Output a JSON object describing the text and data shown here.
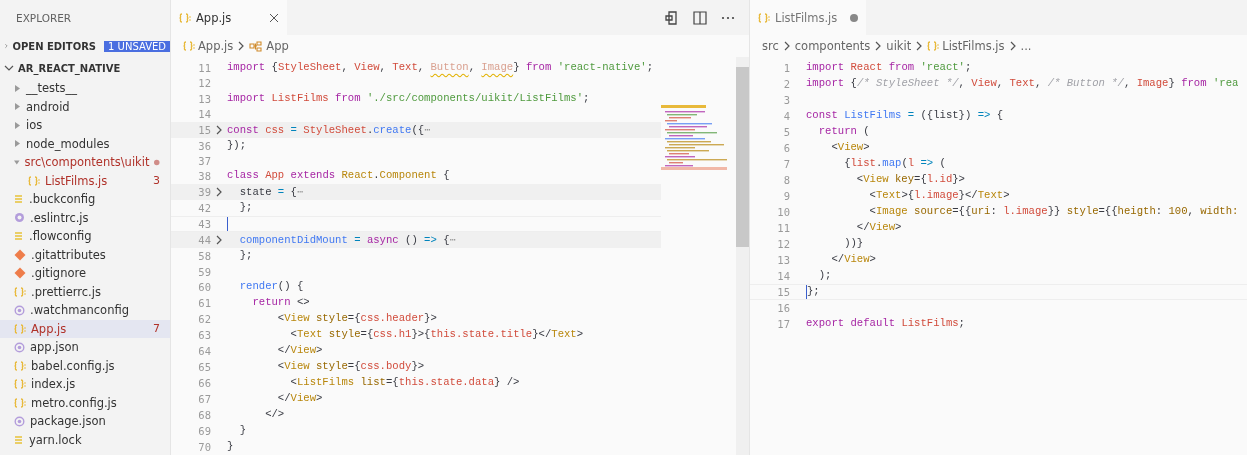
{
  "sidebar": {
    "title": "EXPLORER",
    "sections": [
      {
        "label": "OPEN EDITORS",
        "expanded": false,
        "badge": "1 UNSAVED"
      },
      {
        "label": "AR_REACT_NATIVE",
        "expanded": true,
        "items": [
          {
            "label": "__tests__",
            "kind": "folder",
            "expanded": false,
            "modified": false,
            "selected": false
          },
          {
            "label": "android",
            "kind": "folder",
            "expanded": false,
            "modified": false,
            "selected": false
          },
          {
            "label": "ios",
            "kind": "folder",
            "expanded": false,
            "modified": false,
            "selected": false
          },
          {
            "label": "node_modules",
            "kind": "folder",
            "expanded": false,
            "modified": false,
            "selected": false
          },
          {
            "label": "src\\compontents\\uikit",
            "kind": "folder",
            "expanded": true,
            "modified": true,
            "selected": false,
            "children": [
              {
                "label": "ListFilms.js",
                "kind": "js",
                "modified": true,
                "selected": false,
                "badge": "3"
              }
            ]
          },
          {
            "label": ".buckconfig",
            "kind": "config",
            "modified": false,
            "selected": false
          },
          {
            "label": ".eslintrc.js",
            "kind": "eslint",
            "modified": false,
            "selected": false
          },
          {
            "label": ".flowconfig",
            "kind": "config",
            "modified": false,
            "selected": false
          },
          {
            "label": ".gitattributes",
            "kind": "git",
            "modified": false,
            "selected": false
          },
          {
            "label": ".gitignore",
            "kind": "git",
            "modified": false,
            "selected": false
          },
          {
            "label": ".prettierrc.js",
            "kind": "js",
            "modified": false,
            "selected": false
          },
          {
            "label": ".watchmanconfig",
            "kind": "json",
            "modified": false,
            "selected": false
          },
          {
            "label": "App.js",
            "kind": "js",
            "modified": true,
            "selected": true,
            "badge": "7"
          },
          {
            "label": "app.json",
            "kind": "json",
            "modified": false,
            "selected": false
          },
          {
            "label": "babel.config.js",
            "kind": "js",
            "modified": false,
            "selected": false
          },
          {
            "label": "index.js",
            "kind": "js",
            "modified": false,
            "selected": false
          },
          {
            "label": "metro.config.js",
            "kind": "js",
            "modified": false,
            "selected": false
          },
          {
            "label": "package.json",
            "kind": "json",
            "modified": false,
            "selected": false
          },
          {
            "label": "yarn.lock",
            "kind": "config",
            "modified": false,
            "selected": false
          }
        ]
      }
    ]
  },
  "editors": [
    {
      "focused": true,
      "minimap": true,
      "tab": {
        "label": "App.js",
        "selected": true,
        "dirty": false
      },
      "breadcrumbs": [
        {
          "label": "App.js",
          "kind": "file"
        },
        {
          "label": "App",
          "kind": "symbol"
        }
      ],
      "lines": [
        {
          "n": "11",
          "folded": false,
          "current": false,
          "tokens": [
            {
              "text": "import ",
              "kind": "kw"
            },
            {
              "text": "{",
              "kind": "p"
            },
            {
              "text": "StyleSheet",
              "kind": "var"
            },
            {
              "text": ", ",
              "kind": "p"
            },
            {
              "text": "View",
              "kind": "var"
            },
            {
              "text": ", ",
              "kind": "p"
            },
            {
              "text": "Text",
              "kind": "var"
            },
            {
              "text": ", ",
              "kind": "p"
            },
            {
              "text": "Button",
              "kind": "unused"
            },
            {
              "text": ", ",
              "kind": "p"
            },
            {
              "text": "Image",
              "kind": "unused"
            },
            {
              "text": "} ",
              "kind": "p"
            },
            {
              "text": "from ",
              "kind": "kw"
            },
            {
              "text": "'react-native'",
              "kind": "str"
            },
            {
              "text": ";",
              "kind": "p"
            }
          ]
        },
        {
          "n": "12",
          "folded": false,
          "current": false
        },
        {
          "n": "13",
          "folded": false,
          "current": false,
          "tokens": [
            {
              "text": "import ",
              "kind": "kw"
            },
            {
              "text": "ListFilms ",
              "kind": "var"
            },
            {
              "text": "from ",
              "kind": "kw"
            },
            {
              "text": "'./src/components/uikit/ListFilms'",
              "kind": "str"
            },
            {
              "text": ";",
              "kind": "p"
            }
          ]
        },
        {
          "n": "14",
          "folded": false,
          "current": false
        },
        {
          "n": "15",
          "folded": true,
          "current": false,
          "tokens": [
            {
              "text": "const ",
              "kind": "kw"
            },
            {
              "text": "css ",
              "kind": "var"
            },
            {
              "text": "= ",
              "kind": "op"
            },
            {
              "text": "StyleSheet",
              "kind": "var"
            },
            {
              "text": ".",
              "kind": "p"
            },
            {
              "text": "create",
              "kind": "fn"
            },
            {
              "text": "({",
              "kind": "p"
            },
            {
              "text": "⋯",
              "kind": "fold"
            }
          ]
        },
        {
          "n": "36",
          "folded": false,
          "current": false,
          "tokens": [
            {
              "text": "});",
              "kind": "p"
            }
          ]
        },
        {
          "n": "37",
          "folded": false,
          "current": false
        },
        {
          "n": "38",
          "folded": false,
          "current": false,
          "tokens": [
            {
              "text": "class ",
              "kind": "kw"
            },
            {
              "text": "App ",
              "kind": "var"
            },
            {
              "text": "extends ",
              "kind": "kw"
            },
            {
              "text": "React",
              "kind": "type"
            },
            {
              "text": ".",
              "kind": "p"
            },
            {
              "text": "Component ",
              "kind": "type"
            },
            {
              "text": "{",
              "kind": "p"
            }
          ]
        },
        {
          "n": "39",
          "folded": true,
          "current": false,
          "tokens": [
            {
              "text": "  state ",
              "kind": "p"
            },
            {
              "text": "= ",
              "kind": "op"
            },
            {
              "text": "{",
              "kind": "p"
            },
            {
              "text": "⋯",
              "kind": "fold"
            }
          ]
        },
        {
          "n": "42",
          "folded": false,
          "current": false,
          "tokens": [
            {
              "text": "  };",
              "kind": "p"
            }
          ]
        },
        {
          "n": "43",
          "folded": false,
          "current": true
        },
        {
          "n": "44",
          "folded": true,
          "current": false,
          "tokens": [
            {
              "text": "  componentDidMount ",
              "kind": "fn"
            },
            {
              "text": "= ",
              "kind": "op"
            },
            {
              "text": "async ",
              "kind": "kw"
            },
            {
              "text": "() ",
              "kind": "p"
            },
            {
              "text": "=> ",
              "kind": "op"
            },
            {
              "text": "{",
              "kind": "p"
            },
            {
              "text": "⋯",
              "kind": "fold"
            }
          ]
        },
        {
          "n": "58",
          "folded": false,
          "current": false,
          "tokens": [
            {
              "text": "  };",
              "kind": "p"
            }
          ]
        },
        {
          "n": "59",
          "folded": false,
          "current": false
        },
        {
          "n": "60",
          "folded": false,
          "current": false,
          "tokens": [
            {
              "text": "  render",
              "kind": "fn"
            },
            {
              "text": "() {",
              "kind": "p"
            }
          ]
        },
        {
          "n": "61",
          "folded": false,
          "current": false,
          "tokens": [
            {
              "text": "    return ",
              "kind": "kw"
            },
            {
              "text": "<>",
              "kind": "p"
            }
          ]
        },
        {
          "n": "62",
          "folded": false,
          "current": false,
          "tokens": [
            {
              "text": "        <",
              "kind": "p"
            },
            {
              "text": "View ",
              "kind": "type"
            },
            {
              "text": "style",
              "kind": "attr"
            },
            {
              "text": "={",
              "kind": "p"
            },
            {
              "text": "css.header",
              "kind": "var"
            },
            {
              "text": "}>",
              "kind": "p"
            }
          ]
        },
        {
          "n": "63",
          "folded": false,
          "current": false,
          "tokens": [
            {
              "text": "          <",
              "kind": "p"
            },
            {
              "text": "Text ",
              "kind": "type"
            },
            {
              "text": "style",
              "kind": "attr"
            },
            {
              "text": "={",
              "kind": "p"
            },
            {
              "text": "css.h1",
              "kind": "var"
            },
            {
              "text": "}>{",
              "kind": "p"
            },
            {
              "text": "this.state.title",
              "kind": "var"
            },
            {
              "text": "}</",
              "kind": "p"
            },
            {
              "text": "Text",
              "kind": "type"
            },
            {
              "text": ">",
              "kind": "p"
            }
          ]
        },
        {
          "n": "64",
          "folded": false,
          "current": false,
          "tokens": [
            {
              "text": "        </",
              "kind": "p"
            },
            {
              "text": "View",
              "kind": "type"
            },
            {
              "text": ">",
              "kind": "p"
            }
          ]
        },
        {
          "n": "65",
          "folded": false,
          "current": false,
          "tokens": [
            {
              "text": "        <",
              "kind": "p"
            },
            {
              "text": "View ",
              "kind": "type"
            },
            {
              "text": "style",
              "kind": "attr"
            },
            {
              "text": "={",
              "kind": "p"
            },
            {
              "text": "css.body",
              "kind": "var"
            },
            {
              "text": "}>",
              "kind": "p"
            }
          ]
        },
        {
          "n": "66",
          "folded": false,
          "current": false,
          "tokens": [
            {
              "text": "          <",
              "kind": "p"
            },
            {
              "text": "ListFilms ",
              "kind": "type"
            },
            {
              "text": "list",
              "kind": "attr"
            },
            {
              "text": "={",
              "kind": "p"
            },
            {
              "text": "this.state.data",
              "kind": "var"
            },
            {
              "text": "} />",
              "kind": "p"
            }
          ]
        },
        {
          "n": "67",
          "folded": false,
          "current": false,
          "tokens": [
            {
              "text": "        </",
              "kind": "p"
            },
            {
              "text": "View",
              "kind": "type"
            },
            {
              "text": ">",
              "kind": "p"
            }
          ]
        },
        {
          "n": "68",
          "folded": false,
          "current": false,
          "tokens": [
            {
              "text": "      </>",
              "kind": "p"
            }
          ]
        },
        {
          "n": "69",
          "folded": false,
          "current": false,
          "tokens": [
            {
              "text": "  }",
              "kind": "p"
            }
          ]
        },
        {
          "n": "70",
          "folded": false,
          "current": false,
          "tokens": [
            {
              "text": "}",
              "kind": "p"
            }
          ]
        }
      ]
    },
    {
      "focused": false,
      "minimap": false,
      "tab": {
        "label": "ListFilms.js",
        "selected": true,
        "dirty": true
      },
      "breadcrumbs": [
        {
          "label": "src",
          "kind": "folder"
        },
        {
          "label": "compontents",
          "kind": "folder"
        },
        {
          "label": "uikit",
          "kind": "folder"
        },
        {
          "label": "ListFilms.js",
          "kind": "file"
        },
        {
          "label": "...",
          "kind": "more"
        }
      ],
      "lines": [
        {
          "n": "1",
          "folded": false,
          "current": false,
          "tokens": [
            {
              "text": "import ",
              "kind": "kw"
            },
            {
              "text": "React ",
              "kind": "var"
            },
            {
              "text": "from ",
              "kind": "kw"
            },
            {
              "text": "'react'",
              "kind": "str"
            },
            {
              "text": ";",
              "kind": "p"
            }
          ]
        },
        {
          "n": "2",
          "folded": false,
          "current": false,
          "tokens": [
            {
              "text": "import ",
              "kind": "kw"
            },
            {
              "text": "{",
              "kind": "p"
            },
            {
              "text": "/* StyleSheet */",
              "kind": "comment"
            },
            {
              "text": ", ",
              "kind": "p"
            },
            {
              "text": "View",
              "kind": "var"
            },
            {
              "text": ", ",
              "kind": "p"
            },
            {
              "text": "Text",
              "kind": "var"
            },
            {
              "text": ", ",
              "kind": "p"
            },
            {
              "text": "/* Button */",
              "kind": "comment"
            },
            {
              "text": ", ",
              "kind": "p"
            },
            {
              "text": "Image",
              "kind": "var"
            },
            {
              "text": "} ",
              "kind": "p"
            },
            {
              "text": "from ",
              "kind": "kw"
            },
            {
              "text": "'rea",
              "kind": "str"
            }
          ]
        },
        {
          "n": "3",
          "folded": false,
          "current": false
        },
        {
          "n": "4",
          "folded": false,
          "current": false,
          "tokens": [
            {
              "text": "const ",
              "kind": "kw"
            },
            {
              "text": "ListFilms ",
              "kind": "fn"
            },
            {
              "text": "= ",
              "kind": "op"
            },
            {
              "text": "({list}) ",
              "kind": "p"
            },
            {
              "text": "=> ",
              "kind": "op"
            },
            {
              "text": "{",
              "kind": "p"
            }
          ]
        },
        {
          "n": "5",
          "folded": false,
          "current": false,
          "tokens": [
            {
              "text": "  return ",
              "kind": "kw"
            },
            {
              "text": "(",
              "kind": "p"
            }
          ]
        },
        {
          "n": "6",
          "folded": false,
          "current": false,
          "tokens": [
            {
              "text": "    <",
              "kind": "p"
            },
            {
              "text": "View",
              "kind": "type"
            },
            {
              "text": ">",
              "kind": "p"
            }
          ]
        },
        {
          "n": "7",
          "folded": false,
          "current": false,
          "tokens": [
            {
              "text": "      {",
              "kind": "p"
            },
            {
              "text": "list",
              "kind": "var"
            },
            {
              "text": ".",
              "kind": "p"
            },
            {
              "text": "map",
              "kind": "fn"
            },
            {
              "text": "(",
              "kind": "p"
            },
            {
              "text": "l ",
              "kind": "var"
            },
            {
              "text": "=> ",
              "kind": "op"
            },
            {
              "text": "(",
              "kind": "p"
            }
          ]
        },
        {
          "n": "8",
          "folded": false,
          "current": false,
          "tokens": [
            {
              "text": "        <",
              "kind": "p"
            },
            {
              "text": "View ",
              "kind": "type"
            },
            {
              "text": "key",
              "kind": "attr"
            },
            {
              "text": "={",
              "kind": "p"
            },
            {
              "text": "l.id",
              "kind": "var"
            },
            {
              "text": "}>",
              "kind": "p"
            }
          ]
        },
        {
          "n": "9",
          "folded": false,
          "current": false,
          "tokens": [
            {
              "text": "          <",
              "kind": "p"
            },
            {
              "text": "Text",
              "kind": "type"
            },
            {
              "text": ">{",
              "kind": "p"
            },
            {
              "text": "l.image",
              "kind": "var"
            },
            {
              "text": "}</",
              "kind": "p"
            },
            {
              "text": "Text",
              "kind": "type"
            },
            {
              "text": ">",
              "kind": "p"
            }
          ]
        },
        {
          "n": "10",
          "folded": false,
          "current": false,
          "tokens": [
            {
              "text": "          <",
              "kind": "p"
            },
            {
              "text": "Image ",
              "kind": "type"
            },
            {
              "text": "source",
              "kind": "attr"
            },
            {
              "text": "={{",
              "kind": "p"
            },
            {
              "text": "uri",
              "kind": "attr"
            },
            {
              "text": ": ",
              "kind": "p"
            },
            {
              "text": "l.image",
              "kind": "var"
            },
            {
              "text": "}} ",
              "kind": "p"
            },
            {
              "text": "style",
              "kind": "attr"
            },
            {
              "text": "={{",
              "kind": "p"
            },
            {
              "text": "heigth",
              "kind": "attr"
            },
            {
              "text": ": ",
              "kind": "p"
            },
            {
              "text": "100",
              "kind": "num"
            },
            {
              "text": ", ",
              "kind": "p"
            },
            {
              "text": "width:",
              "kind": "attr"
            }
          ]
        },
        {
          "n": "11",
          "folded": false,
          "current": false,
          "tokens": [
            {
              "text": "        </",
              "kind": "p"
            },
            {
              "text": "View",
              "kind": "type"
            },
            {
              "text": ">",
              "kind": "p"
            }
          ]
        },
        {
          "n": "12",
          "folded": false,
          "current": false,
          "tokens": [
            {
              "text": "      ))}",
              "kind": "p"
            }
          ]
        },
        {
          "n": "13",
          "folded": false,
          "current": false,
          "tokens": [
            {
              "text": "    </",
              "kind": "p"
            },
            {
              "text": "View",
              "kind": "type"
            },
            {
              "text": ">",
              "kind": "p"
            }
          ]
        },
        {
          "n": "14",
          "folded": false,
          "current": false,
          "tokens": [
            {
              "text": "  );",
              "kind": "p"
            }
          ]
        },
        {
          "n": "15",
          "folded": false,
          "current": true,
          "tokens": [
            {
              "text": "};",
              "kind": "p"
            }
          ]
        },
        {
          "n": "16",
          "folded": false,
          "current": false
        },
        {
          "n": "17",
          "folded": false,
          "current": false,
          "tokens": [
            {
              "text": "export ",
              "kind": "kw"
            },
            {
              "text": "default ",
              "kind": "kw"
            },
            {
              "text": "ListFilms",
              "kind": "var"
            },
            {
              "text": ";",
              "kind": "p"
            }
          ]
        }
      ]
    }
  ]
}
